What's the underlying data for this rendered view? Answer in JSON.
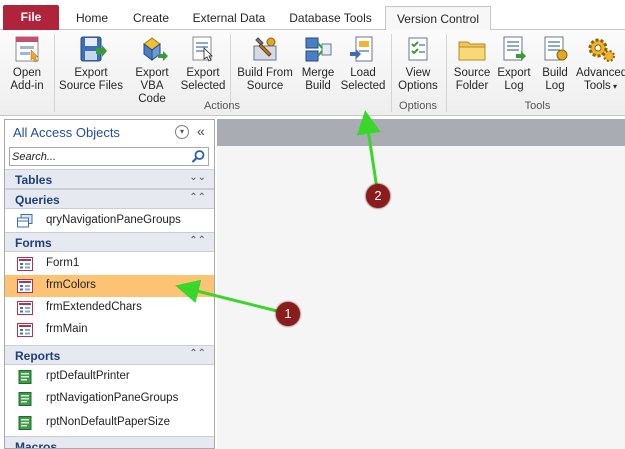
{
  "tabs": [
    {
      "label": "File"
    },
    {
      "label": "Home"
    },
    {
      "label": "Create"
    },
    {
      "label": "External Data"
    },
    {
      "label": "Database Tools"
    },
    {
      "label": "Version Control"
    }
  ],
  "ribbon": {
    "open_addin": {
      "line1": "Open",
      "line2": "Add-in"
    },
    "export_source": {
      "line1": "Export",
      "line2": "Source Files"
    },
    "export_vba": {
      "line1": "Export",
      "line2": "VBA Code"
    },
    "export_selected": {
      "line1": "Export",
      "line2": "Selected"
    },
    "build_from_source": {
      "line1": "Build From",
      "line2": "Source"
    },
    "merge_build": {
      "line1": "Merge",
      "line2": "Build"
    },
    "load_selected": {
      "line1": "Load",
      "line2": "Selected"
    },
    "view_options": {
      "line1": "View",
      "line2": "Options"
    },
    "source_folder": {
      "line1": "Source",
      "line2": "Folder"
    },
    "export_log": {
      "line1": "Export",
      "line2": "Log"
    },
    "build_log": {
      "line1": "Build",
      "line2": "Log"
    },
    "advanced_tools": {
      "line1": "Advanced",
      "line2": "Tools"
    },
    "groups": {
      "actions": "Actions",
      "options": "Options",
      "tools": "Tools"
    }
  },
  "nav": {
    "title": "All Access Objects",
    "search_placeholder": "Search...",
    "sections": {
      "tables": "Tables",
      "queries": "Queries",
      "forms": "Forms",
      "reports": "Reports",
      "macros": "Macros"
    },
    "queries": [
      "qryNavigationPaneGroups"
    ],
    "forms": [
      "Form1",
      "frmColors",
      "frmExtendedChars",
      "frmMain"
    ],
    "reports": [
      "rptDefaultPrinter",
      "rptNavigationPaneGroups",
      "rptNonDefaultPaperSize"
    ],
    "selected_item": "frmColors"
  },
  "callouts": {
    "one": "1",
    "two": "2"
  },
  "colors": {
    "file_tab": "#b0243b",
    "selected_row": "#fcc374",
    "callout": "#8a1c1c",
    "arrow": "#39d62b"
  }
}
